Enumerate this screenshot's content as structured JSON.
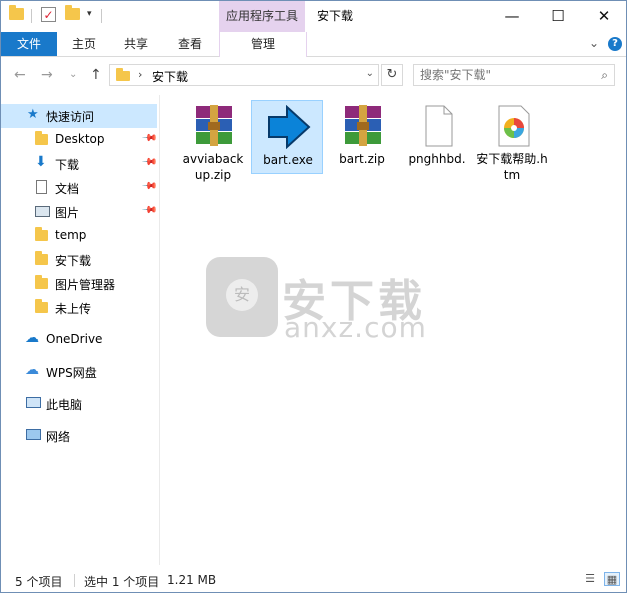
{
  "titlebar": {
    "context_tab_title": "应用程序工具",
    "window_title": "安下载"
  },
  "ribbon": {
    "tabs": [
      {
        "label": "文件"
      },
      {
        "label": "主页"
      },
      {
        "label": "共享"
      },
      {
        "label": "查看"
      },
      {
        "label": "管理"
      }
    ]
  },
  "address_bar": {
    "path_segment": "安下载",
    "search_placeholder": "搜索\"安下载\""
  },
  "navpane": {
    "quick_access": "快速访问",
    "items": [
      {
        "label": "Desktop",
        "icon": "folder-icon",
        "pinned": true
      },
      {
        "label": "下载",
        "icon": "download-icon",
        "pinned": true
      },
      {
        "label": "文档",
        "icon": "document-icon",
        "pinned": true
      },
      {
        "label": "图片",
        "icon": "picture-icon",
        "pinned": true
      },
      {
        "label": "temp",
        "icon": "folder-icon",
        "pinned": false
      },
      {
        "label": "安下载",
        "icon": "folder-icon",
        "pinned": false
      },
      {
        "label": "图片管理器",
        "icon": "folder-icon",
        "pinned": false
      },
      {
        "label": "未上传",
        "icon": "folder-icon",
        "pinned": false
      }
    ],
    "onedrive": "OneDrive",
    "wps": "WPS网盘",
    "this_pc": "此电脑",
    "network": "网络"
  },
  "files": [
    {
      "name": "avviaback up.zip",
      "type": "winrar-archive-icon",
      "selected": false
    },
    {
      "name": "bart.exe",
      "type": "blue-arrow-exe-icon",
      "selected": true
    },
    {
      "name": "bart.zip",
      "type": "winrar-archive-icon",
      "selected": false
    },
    {
      "name": "pnghhbd.",
      "type": "blank-file-icon",
      "selected": false
    },
    {
      "name": "安下载帮助.htm",
      "type": "html-file-icon",
      "selected": false
    }
  ],
  "watermark": {
    "title": "安下载",
    "subtitle": "anxz.com"
  },
  "statusbar": {
    "item_count": "5 个项目",
    "selected": "选中 1 个项目",
    "size": "1.21 MB"
  },
  "colors": {
    "accent": "#1979ca",
    "selection": "#cce8ff",
    "context_tab": "#e5d2ee",
    "folder": "#f5c64b"
  }
}
